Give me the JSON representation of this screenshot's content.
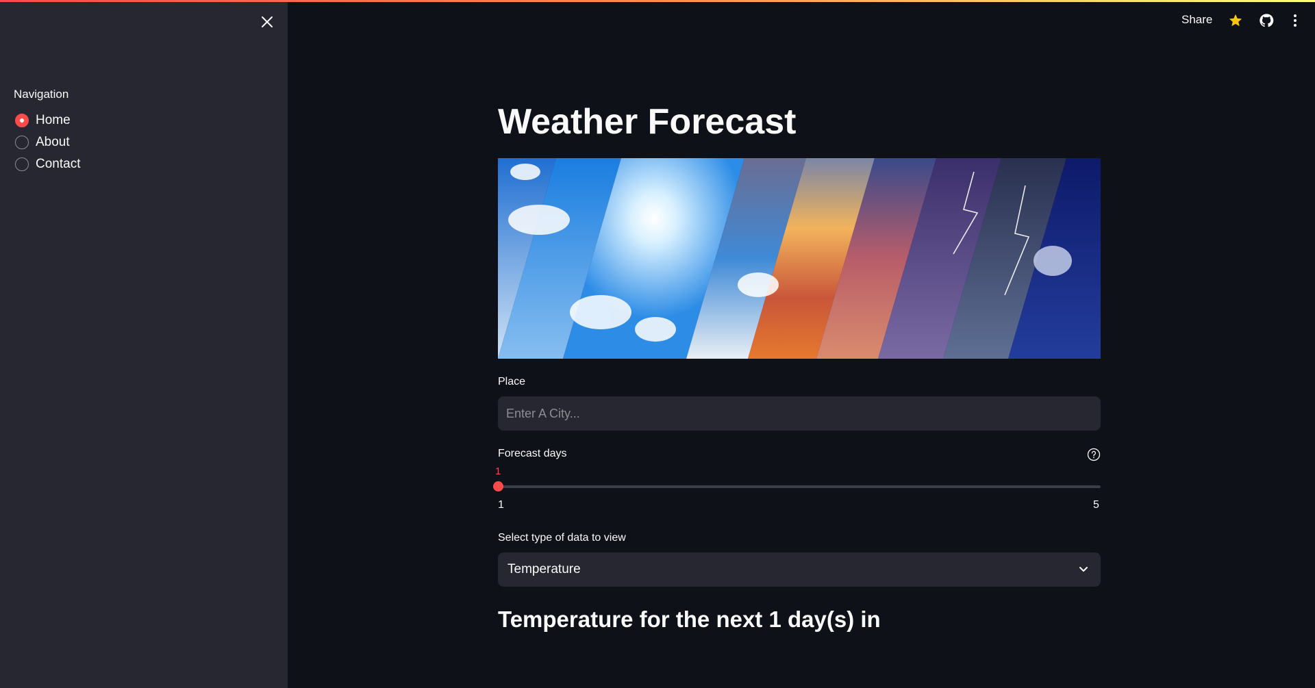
{
  "sidebar": {
    "nav_label": "Navigation",
    "items": [
      {
        "label": "Home",
        "selected": true
      },
      {
        "label": "About",
        "selected": false
      },
      {
        "label": "Contact",
        "selected": false
      }
    ]
  },
  "header": {
    "share_label": "Share",
    "icons": [
      "star-icon",
      "github-icon",
      "more-vert-icon"
    ]
  },
  "main": {
    "title": "Weather Forecast",
    "place": {
      "label": "Place",
      "placeholder": "Enter A City...",
      "value": ""
    },
    "forecast_days": {
      "label": "Forecast days",
      "value": "1",
      "min": "1",
      "max": "5"
    },
    "data_type": {
      "label": "Select type of data to view",
      "selected": "Temperature"
    },
    "subheader": "Temperature for the next 1 day(s) in"
  },
  "colors": {
    "accent": "#ff4b4b",
    "background": "#0e1117",
    "sidebar": "#262730",
    "widget": "#262730"
  }
}
